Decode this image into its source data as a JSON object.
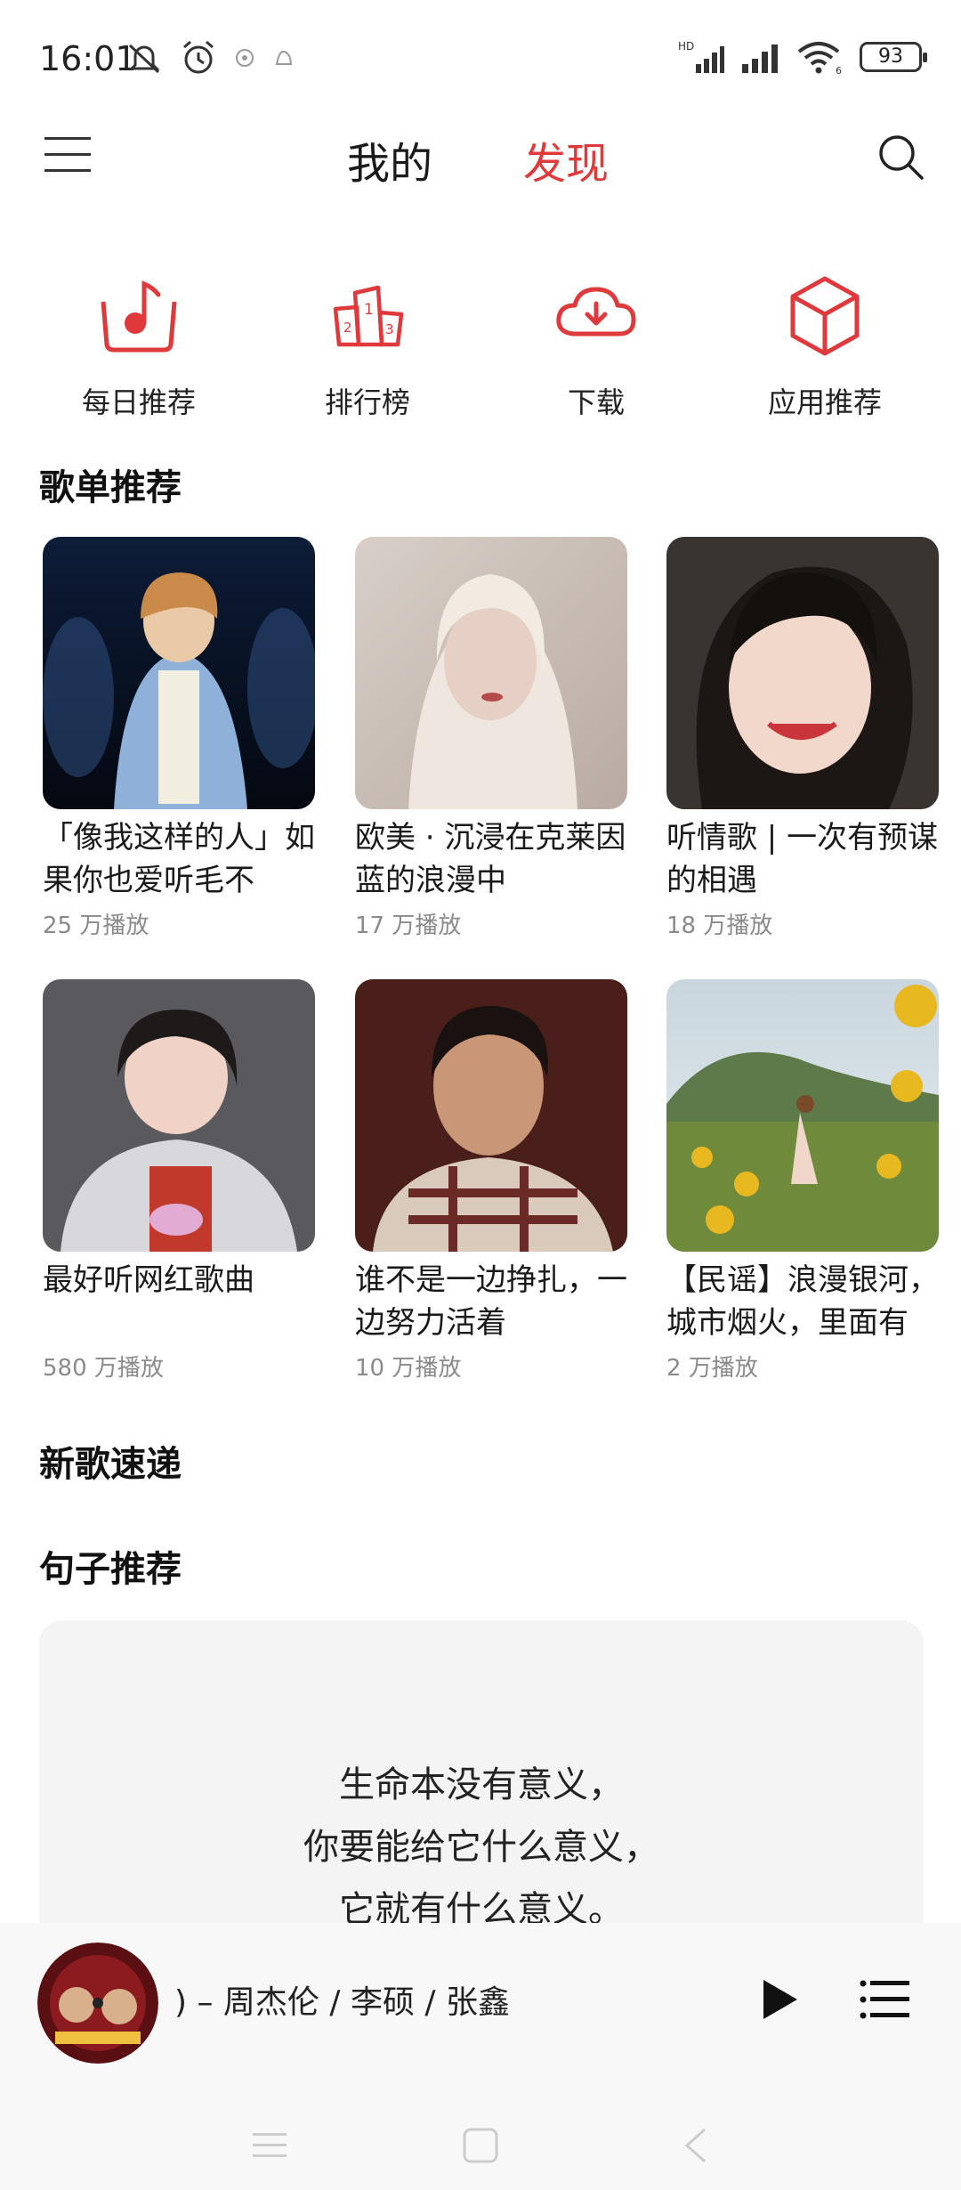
{
  "status_bar": {
    "time": "16:01",
    "battery": "93",
    "network_badge": "HD",
    "wifi_badge": "6"
  },
  "header": {
    "tabs": [
      {
        "label": "我的",
        "active": false
      },
      {
        "label": "发现",
        "active": true
      }
    ],
    "accent_color": "#e0393b"
  },
  "quick_entries": [
    {
      "label": "每日推荐",
      "icon": "daily-music-note-icon"
    },
    {
      "label": "排行榜",
      "icon": "podium-icon"
    },
    {
      "label": "下载",
      "icon": "cloud-download-icon"
    },
    {
      "label": "应用推荐",
      "icon": "cube-icon"
    }
  ],
  "playlists": {
    "title": "歌单推荐",
    "items": [
      {
        "title": "「像我这样的人」如果你也爱听毛不",
        "plays": "25 万播放"
      },
      {
        "title": "欧美 · 沉浸在克莱因蓝的浪漫中",
        "plays": "17 万播放"
      },
      {
        "title": "听情歌 | 一次有预谋的相遇",
        "plays": "18 万播放"
      },
      {
        "title": "最好听网红歌曲",
        "plays": "580 万播放"
      },
      {
        "title": "谁不是一边挣扎，一边努力活着",
        "plays": "10 万播放"
      },
      {
        "title": "【民谣】浪漫银河，城市烟火，里面有",
        "plays": "2 万播放"
      }
    ]
  },
  "new_songs": {
    "title": "新歌速递"
  },
  "quote": {
    "title": "句子推荐",
    "lines": [
      "生命本没有意义，",
      "你要能给它什么意义，",
      "它就有什么意义。"
    ]
  },
  "player": {
    "song_text": ") – 周杰伦 / 李硕 / 张鑫"
  }
}
